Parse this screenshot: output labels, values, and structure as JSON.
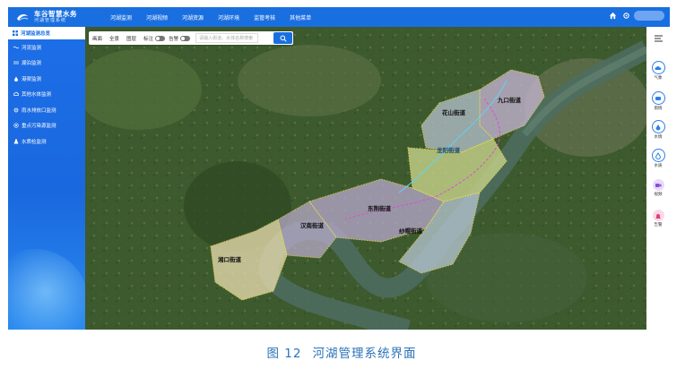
{
  "app": {
    "title": "车谷智慧水务",
    "subtitle": "河湖管理系统"
  },
  "nav": {
    "items": [
      "河湖监测",
      "河湖视频",
      "河湖资源",
      "河湖环境",
      "监管考核",
      "其他菜单"
    ]
  },
  "sidebar": {
    "overview_label": "河湖监测总览",
    "items": [
      {
        "label": "河流监测",
        "icon": "wave-icon"
      },
      {
        "label": "湖泊监测",
        "icon": "lines-icon"
      },
      {
        "label": "港渠监测",
        "icon": "drop-icon"
      },
      {
        "label": "其他水体监测",
        "icon": "cloud-icon"
      },
      {
        "label": "雨水排放口监测",
        "icon": "gear-icon"
      },
      {
        "label": "重点污染源监测",
        "icon": "target-icon"
      },
      {
        "label": "水质检监测",
        "icon": "flask-icon"
      }
    ]
  },
  "toolbar": {
    "buttons": [
      "画面",
      "全景",
      "图层"
    ],
    "toggle_label_1": "标注",
    "toggle_label_2": "告警",
    "search_placeholder": "请输入街道、水体名称搜索"
  },
  "map": {
    "labels": [
      "花山街道",
      "龙阳街道",
      "九口街道",
      "东荆街道",
      "汉南街道",
      "纱帽街道",
      "湘口街道"
    ]
  },
  "right_tools": [
    {
      "label": "气象",
      "icon": "weather-icon",
      "color": "#2d7ee8"
    },
    {
      "label": "雨情",
      "icon": "rain-icon",
      "color": "#2d7ee8"
    },
    {
      "label": "水情",
      "icon": "water-icon",
      "color": "#2d7ee8"
    },
    {
      "label": "水质",
      "icon": "quality-icon",
      "color": "#2d7ee8"
    },
    {
      "label": "视频",
      "icon": "video-icon",
      "color": "#8a4fd8"
    },
    {
      "label": "告警",
      "icon": "alarm-icon",
      "color": "#e0407a"
    }
  ],
  "caption": {
    "figure": "图 12",
    "title": "河湖管理系统界面"
  }
}
